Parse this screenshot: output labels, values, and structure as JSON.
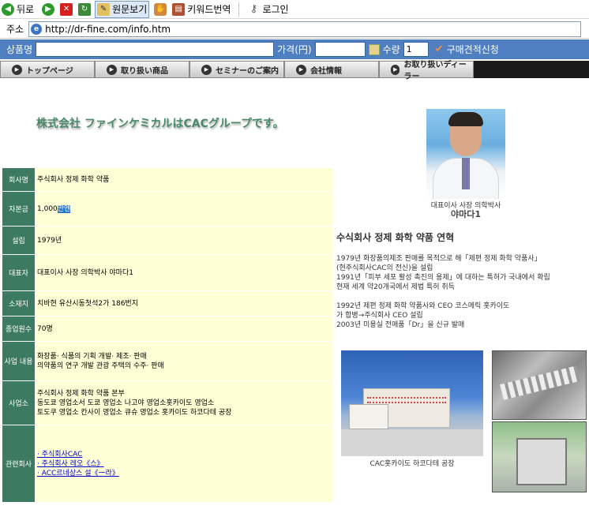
{
  "browser_toolbar": {
    "back_label": "뒤로",
    "original_view_label": "원문보기",
    "keyword_translate_label": "키워드번역",
    "login_label": "로그인"
  },
  "address_bar": {
    "label": "주소",
    "url": "http://dr-fine.com/info.htm"
  },
  "product_bar": {
    "product_label": "상품명",
    "price_label": "가격(円)",
    "quantity_label": "수량",
    "quantity_value": "1",
    "order_label": "구매견적신청",
    "bar_color": "#4f7fc0"
  },
  "site_nav": {
    "items": [
      {
        "label": "トップページ"
      },
      {
        "label": "取り扱い商品"
      },
      {
        "label": "セミナーのご案内"
      },
      {
        "label": "会社情報"
      },
      {
        "label": "お取り扱いディーラー"
      }
    ]
  },
  "page": {
    "heading": "株式会社 ファインケミカルはCACグループです。",
    "heading_color": "#4a8a6a"
  },
  "company_info": {
    "header_color": "#3d7a62",
    "value_bg_color": "#ffffd6",
    "rows": [
      {
        "label": "회사명",
        "lines": [
          "주식회사 정제 화학 약품"
        ]
      },
      {
        "label": "자본금",
        "value_prefix": "1,000",
        "value_highlight": "만엔"
      },
      {
        "label": "설립",
        "lines": [
          "1979년"
        ]
      },
      {
        "label": "대표자",
        "lines": [
          "대표이사 사장 의학박사 야마다1"
        ]
      },
      {
        "label": "소재지",
        "lines": [
          "치바현 유산시동첫석2가 186번지"
        ]
      },
      {
        "label": "종업원수",
        "lines": [
          "70명"
        ]
      },
      {
        "label": "사업 내용",
        "lines": [
          "화장품· 식품의 기획 개발· 제조· 판매",
          "의약품의 연구 개발 관광 주택의 수주· 판매"
        ]
      },
      {
        "label": "사업소",
        "lines": [
          "주식회사 정제 화학 약품 본부",
          "동도쿄 영업소서 도쿄 영업소 나고야 영업소홋카이도 영업소",
          "토도쿠 영업소 칸사이 영업소 큐슈 영업소 홋카이도 하코다테 공장"
        ]
      },
      {
        "label": "관련회사",
        "links": [
          "· 주식회사CAC",
          "· 주식회사 레오《스》",
          "· ACC르네상스 설《一라》"
        ]
      }
    ]
  },
  "president": {
    "caption": "대표이사 사장 의학박사",
    "name": "야마다1"
  },
  "history": {
    "title": "수식회사 정제 화학 약품 연혁",
    "lines": [
      "1979년 화장품의제조 판매를 목적으로 해「제편 정제 화학 약품사」",
      "(현주식회사CAC의 전신)을 설립",
      "1991년「피부 세포 활성 촉진의 용제」에 대하는 특허가 국내에서 확립",
      "현재 세계 약20개국에서 제법 특허 취득",
      "",
      "1992년 제편 정제 화학 약품사와 CEO 코스메릭 홋카이도",
      "가 합병→주식회사 CEO 설립",
      "2003년 미용실 전매품「Dr」을 신규 발매"
    ]
  },
  "factory": {
    "caption": "CAC홋카이도 하코다테 공장"
  }
}
